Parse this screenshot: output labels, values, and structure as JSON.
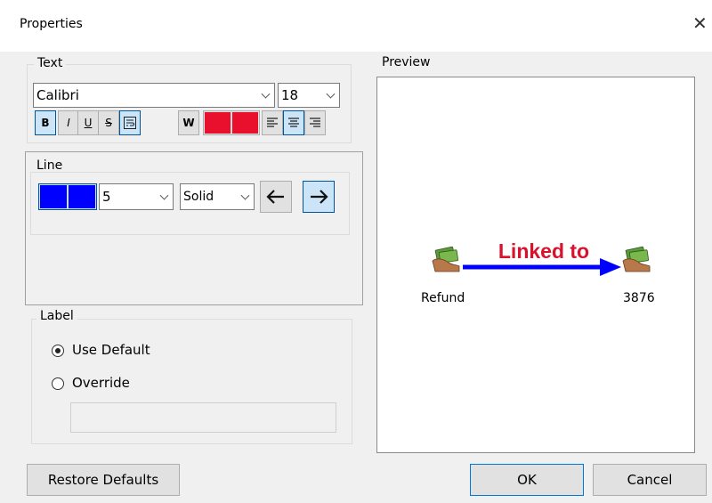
{
  "window": {
    "title": "Properties"
  },
  "text_group": {
    "legend": "Text",
    "font": "Calibri",
    "size": "18",
    "buttons": {
      "bold": "B",
      "italic": "I",
      "underline": "U",
      "strike": "S",
      "wrap_icon": "wrap-text-icon",
      "white": "W",
      "align_left_icon": "align-left-icon",
      "align_center_icon": "align-center-icon",
      "align_right_icon": "align-right-icon"
    },
    "text_color": "#e8102c"
  },
  "line_group": {
    "legend": "Line",
    "color": "#0000ff",
    "width": "5",
    "style": "Solid",
    "arrow_left_icon": "arrow-left-icon",
    "arrow_right_icon": "arrow-right-icon"
  },
  "label_group": {
    "legend": "Label",
    "use_default": "Use Default",
    "override": "Override",
    "override_value": ""
  },
  "preview": {
    "label": "Preview",
    "link_text": "Linked to",
    "link_color": "#d9112c",
    "line_color": "#0000ff",
    "left_node": "Refund",
    "right_node": "3876",
    "node_icon": "hand-money-icon"
  },
  "buttons": {
    "restore": "Restore Defaults",
    "ok": "OK",
    "cancel": "Cancel"
  }
}
